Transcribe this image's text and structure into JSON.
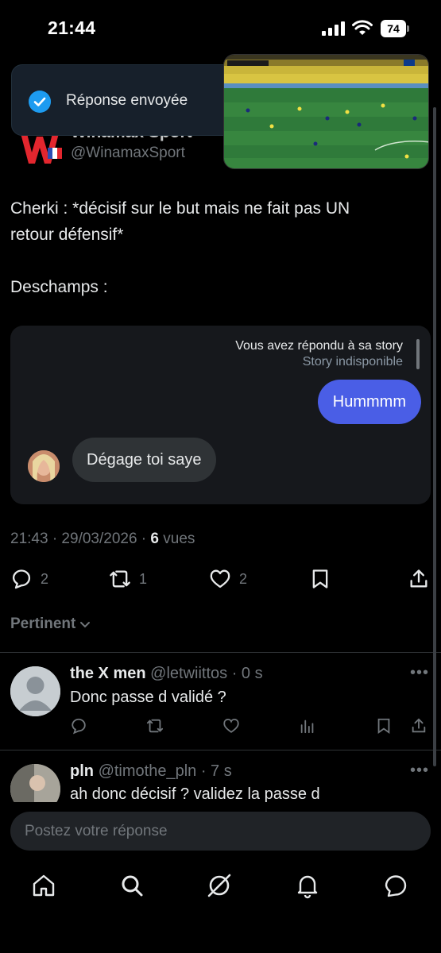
{
  "status_bar": {
    "time": "21:44",
    "battery": "74"
  },
  "toast": {
    "text": "Réponse envoyée"
  },
  "author": {
    "name": "Winamax Sport",
    "handle": "@WinamaxSport"
  },
  "tweet": {
    "line1": "Cherki : *décisif sur le but mais ne fait pas UN",
    "line2": "retour défensif*",
    "line3": "Deschamps :"
  },
  "dm": {
    "note_line1": "Vous avez répondu à sa story",
    "note_line2": "Story indisponible",
    "sent_message": "Hummmm",
    "received_message": "Dégage toi saye"
  },
  "meta": {
    "time_date": "21:43 · 29/03/2026 · ",
    "views_count": "6",
    "views_label": " vues"
  },
  "actions": {
    "replies": "2",
    "reposts": "1",
    "likes": "2"
  },
  "sort": {
    "label": "Pertinent"
  },
  "replies": [
    {
      "name": "the X men",
      "handle": "@letwiittos",
      "time": "· 0 s",
      "text": "Donc passe d validé ?"
    },
    {
      "name": "pln",
      "handle": "@timothe_pln",
      "time": "· 7 s",
      "text": "ah donc décisif ? validez la passe d"
    }
  ],
  "compose": {
    "placeholder": "Postez votre réponse"
  },
  "colors": {
    "accent": "#1d9bf0",
    "dm_sent": "#4a5ee6",
    "background": "#000000"
  }
}
